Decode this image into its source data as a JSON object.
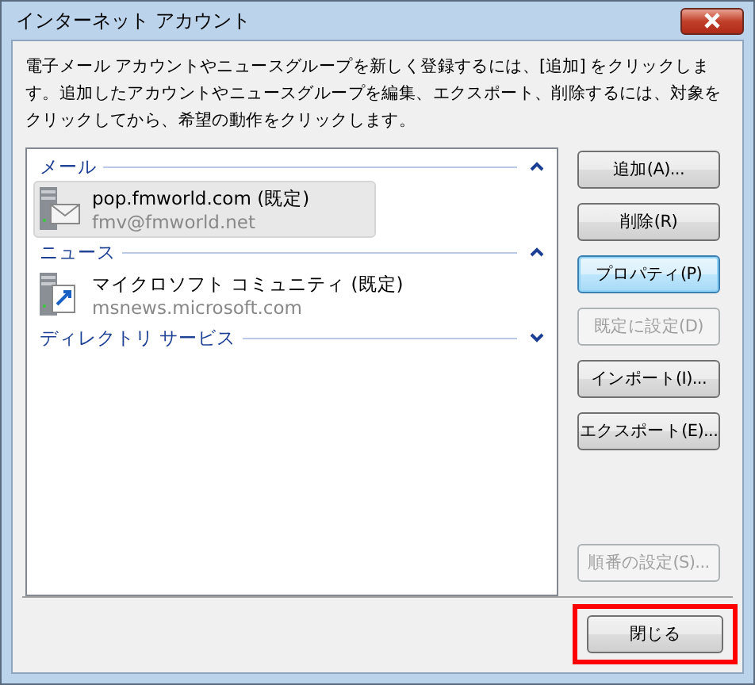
{
  "window": {
    "title": "インターネット アカウント"
  },
  "description": "電子メール アカウントやニュースグループを新しく登録するには、[追加] をクリックします。追加したアカウントやニュースグループを編集、エクスポート、削除するには、対象をクリックしてから、希望の動作をクリックします。",
  "groups": [
    {
      "name": "メール",
      "expanded": true,
      "items": [
        {
          "kind": "mail",
          "name": "pop.fmworld.com (既定)",
          "address": "fmv@fmworld.net",
          "selected": true
        }
      ]
    },
    {
      "name": "ニュース",
      "expanded": true,
      "items": [
        {
          "kind": "news",
          "name": "マイクロソフト コミュニティ (既定)",
          "address": "msnews.microsoft.com",
          "selected": false
        }
      ]
    },
    {
      "name": "ディレクトリ サービス",
      "expanded": false
    }
  ],
  "buttons": [
    {
      "label": "追加(A)...",
      "disabled": false,
      "focused": false
    },
    {
      "label": "削除(R)",
      "disabled": false,
      "focused": false
    },
    {
      "label": "プロパティ(P)",
      "disabled": false,
      "focused": true
    },
    {
      "label": "既定に設定(D)",
      "disabled": true,
      "focused": false
    },
    {
      "label": "インポート(I)...",
      "disabled": false,
      "focused": false
    },
    {
      "label": "エクスポート(E)...",
      "disabled": false,
      "focused": false
    }
  ],
  "order_button": {
    "label": "順番の設定(S)...",
    "disabled": true
  },
  "close_button": {
    "label": "閉じる",
    "highlighted": true
  }
}
